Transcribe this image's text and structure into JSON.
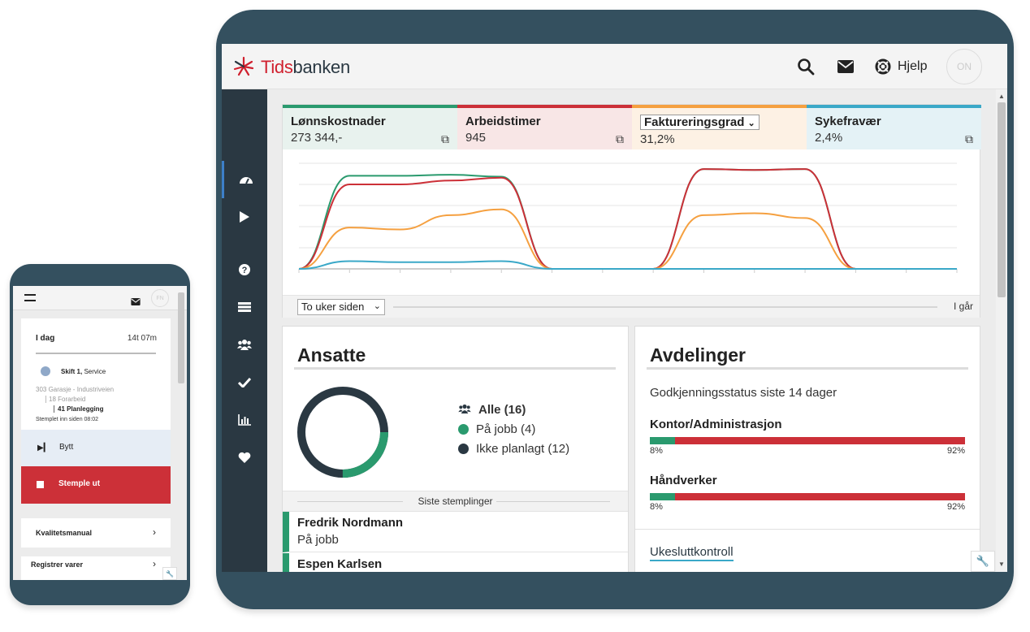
{
  "app": {
    "logo_prefix": "Tids",
    "logo_suffix": "banken",
    "accent": "#d0202e"
  },
  "topbar": {
    "help_label": "Hjelp",
    "avatar_initials": "ON"
  },
  "kpis": [
    {
      "title": "Lønnskostnader",
      "value": "273 344,-",
      "color": "#2a9a6e",
      "bg": "#e8f2ee"
    },
    {
      "title": "Arbeidstimer",
      "value": "945",
      "color": "#cc3038",
      "bg": "#f8e6e6"
    },
    {
      "title": "Faktureringsgrad",
      "value": "31,2%",
      "color": "#f5a040",
      "bg": "#fdf1e4"
    },
    {
      "title": "Sykefravær",
      "value": "2,4%",
      "color": "#3aa8c8",
      "bg": "#e4f2f6"
    }
  ],
  "chart_data": {
    "type": "line",
    "x": [
      1,
      2,
      3,
      4,
      5,
      6,
      7,
      8,
      9,
      10,
      11,
      12,
      13,
      14
    ],
    "series": [
      {
        "color": "#2a9a6e",
        "values": [
          0,
          97,
          97,
          98,
          96,
          0,
          0,
          0,
          104,
          103,
          104,
          0,
          0,
          0
        ]
      },
      {
        "color": "#cc3038",
        "values": [
          0,
          88,
          88,
          92,
          95,
          0,
          0,
          0,
          104,
          103,
          104,
          0,
          0,
          0
        ]
      },
      {
        "color": "#f5a040",
        "values": [
          0,
          43,
          41,
          56,
          62,
          0,
          0,
          0,
          56,
          58,
          53,
          0,
          0,
          0
        ]
      },
      {
        "color": "#3aa8c8",
        "values": [
          0,
          8,
          7,
          7,
          8,
          0,
          0,
          0,
          0,
          0,
          0,
          0,
          0,
          0
        ]
      }
    ],
    "ylim": [
      0,
      110
    ],
    "grid": true,
    "range_select": "To uker siden",
    "range_end": "I går"
  },
  "ansatte": {
    "title": "Ansatte",
    "legend": [
      {
        "label": "Alle (16)",
        "icon": "group-icon"
      },
      {
        "label": "På jobb (4)",
        "color": "#2a9a6e"
      },
      {
        "label": "Ikke planlagt (12)",
        "color": "#2a3842"
      }
    ],
    "donut": {
      "on_job": 4,
      "total": 16
    },
    "recent_header": "Siste stemplinger",
    "recent": [
      {
        "name": "Fredrik Nordmann",
        "status": "På jobb"
      },
      {
        "name": "Espen Karlsen",
        "status": ""
      }
    ]
  },
  "avdelinger": {
    "title": "Avdelinger",
    "subtitle": "Godkjenningsstatus siste 14 dager",
    "departments": [
      {
        "name": "Kontor/Administrasjon",
        "approved": 8,
        "approved_label": "8%",
        "pending_label": "92%"
      },
      {
        "name": "Håndverker",
        "approved": 8,
        "approved_label": "8%",
        "pending_label": "92%"
      }
    ],
    "link": "Ukesluttkontroll"
  },
  "phone": {
    "avatar_initials": "FN",
    "today_label": "I dag",
    "today_hours": "14t 07m",
    "shift_label": "Skift 1,",
    "shift_type": "Service",
    "line1": "303 Garasje - Industriveien",
    "line2": "18 Forarbeid",
    "line3": "41 Planlegging",
    "stamped": "Stemplet inn siden 08:02",
    "switch_label": "Bytt",
    "stamp_out_label": "Stemple ut",
    "menu": [
      "Kvalitetsmanual",
      "Registrer varer"
    ]
  }
}
